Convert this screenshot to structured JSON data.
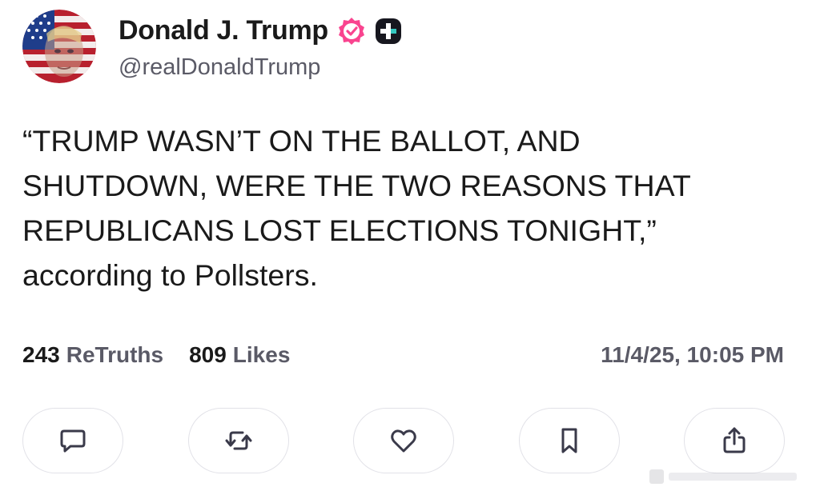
{
  "author": {
    "display_name": "Donald J. Trump",
    "handle": "@realDonaldTrump",
    "avatar_icon": "flag-portrait-avatar",
    "verified_icon": "verified-badge-icon",
    "badge_icon": "truth-plus-icon",
    "verified_color": "#f9448f"
  },
  "post": {
    "lines": [
      "“TRUMP WASN’T ON THE BALLOT, AND",
      "SHUTDOWN, WERE THE TWO REASONS THAT",
      "REPUBLICANS LOST ELECTIONS TONIGHT,”",
      "according to Pollsters."
    ]
  },
  "stats": {
    "retruths_count": "243",
    "retruths_label": "ReTruths",
    "likes_count": "809",
    "likes_label": "Likes",
    "timestamp": "11/4/25, 10:05 PM"
  },
  "actions": [
    {
      "name": "reply",
      "icon": "speech-bubble-icon"
    },
    {
      "name": "retruth",
      "icon": "repost-arrows-icon"
    },
    {
      "name": "like",
      "icon": "heart-icon"
    },
    {
      "name": "bookmark",
      "icon": "bookmark-icon"
    },
    {
      "name": "share",
      "icon": "share-icon"
    }
  ]
}
